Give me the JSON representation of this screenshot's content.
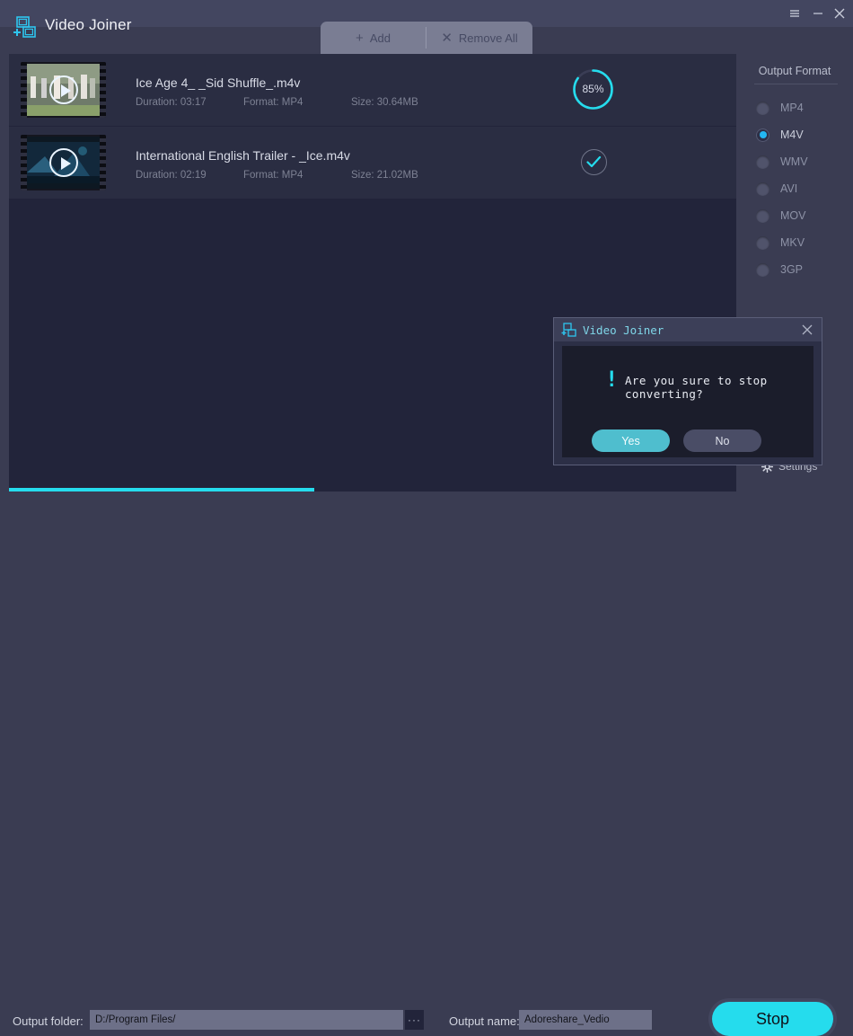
{
  "window": {
    "title": "Video Joiner",
    "controls": [
      {
        "name": "menu-icon",
        "label": "☰"
      },
      {
        "name": "minimize-icon",
        "label": "–"
      },
      {
        "name": "close-icon",
        "label": "✕"
      }
    ]
  },
  "toolbar": {
    "add_label": "Add",
    "add_glyph": "+",
    "remove_label": "Remove All",
    "remove_glyph": "✕"
  },
  "files": [
    {
      "name": "Ice Age 4_ _Sid Shuffle_.m4v",
      "duration_label": "Duration: 03:17",
      "format_label": "Format: MP4",
      "size_label": "Size: 30.64MB",
      "status": "converting",
      "progress": 85,
      "progress_label": "85%"
    },
    {
      "name": "International English Trailer - _Ice.m4v",
      "duration_label": "Duration: 02:19",
      "format_label": "Format: MP4",
      "size_label": "Size: 21.02MB",
      "status": "done",
      "progress": 100,
      "progress_label": ""
    }
  ],
  "output_format": {
    "title": "Output Format",
    "selected": "M4V",
    "options": [
      "MP4",
      "M4V",
      "WMV",
      "AVI",
      "MOV",
      "MKV",
      "3GP"
    ]
  },
  "settings": {
    "label": "Settings",
    "icon": "gear-icon"
  },
  "overall_progress": {
    "percent": 42,
    "color": "#25dced"
  },
  "bottom": {
    "folder_label": "Output folder:",
    "folder_value": "D:/Program Files/",
    "folder_placeholder": "D:/Program Files/",
    "browse_label": "···",
    "name_label": "Output name:",
    "name_value": "Adoreshare_Vedio",
    "name_placeholder": "Adoreshare_Vedio",
    "stop_label": "Stop"
  },
  "dialog": {
    "title": "Video Joiner",
    "message": "Are you sure to stop converting?",
    "bang": "!",
    "yes_label": "Yes",
    "no_label": "No",
    "close_glyph": "✕"
  },
  "colors": {
    "accent": "#25dced",
    "window_bg": "#3a3c52",
    "list_bg": "#22243a",
    "row_bg": "#2a2d42",
    "tab_panel": "#7a7d93"
  }
}
